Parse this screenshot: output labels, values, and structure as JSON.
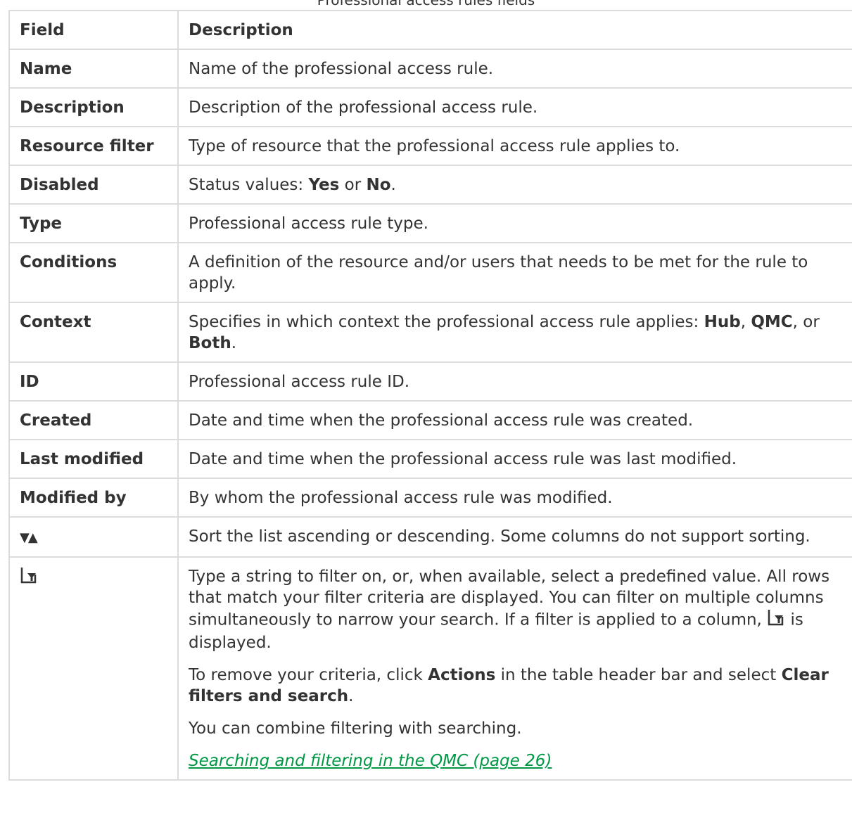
{
  "caption": "Professional access rules fields",
  "headers": {
    "field": "Field",
    "description": "Description"
  },
  "rows": [
    {
      "field": "Name",
      "desc": "Name of the professional access rule."
    },
    {
      "field": "Description",
      "desc": "Description of the professional access rule."
    },
    {
      "field": "Resource filter",
      "desc": "Type of resource that the professional access rule applies to."
    },
    {
      "field": "Disabled",
      "desc_pre": "Status values: ",
      "yes": "Yes",
      "or": " or ",
      "no": "No",
      "end": "."
    },
    {
      "field": "Type",
      "desc": "Professional access rule type."
    },
    {
      "field": "Conditions",
      "desc": "A definition of the resource and/or users that needs to be met for the rule to apply."
    },
    {
      "field": "Context",
      "desc_pre": "Specifies in which context the professional access rule applies: ",
      "hub": "Hub",
      "comma1": ", ",
      "qmc": "QMC",
      "comma2": ", or ",
      "both": "Both",
      "end": "."
    },
    {
      "field": "ID",
      "desc": "Professional access rule ID."
    },
    {
      "field": "Created",
      "desc": "Date and time when the professional access rule was created."
    },
    {
      "field": "Last modified",
      "desc": "Date and time when the professional access rule was last modified."
    },
    {
      "field": "Modified by",
      "desc": "By whom the professional access rule was modified."
    }
  ],
  "sort_row": {
    "icon": "sort-icon",
    "glyph": "▼▲",
    "desc": "Sort the list ascending or descending. Some columns do not support sorting."
  },
  "filter_row": {
    "icon": "filter-icon",
    "p1_pre": "Type a string to filter on, or, when available, select a predefined value. All rows that match your filter criteria are displayed. You can filter on multiple columns simultaneously to narrow your search. If a filter is applied to a column, ",
    "p1_post": " is displayed.",
    "p2_pre": "To remove your criteria, click ",
    "p2_actions": "Actions",
    "p2_mid": " in the table header bar and select ",
    "p2_clear": "Clear filters and search",
    "p2_end": ".",
    "p3": "You can combine filtering with searching.",
    "link": " Searching and filtering in the QMC (page 26)"
  },
  "colors": {
    "link": "#009845",
    "border": "#dcdcdc",
    "text": "#333333"
  }
}
